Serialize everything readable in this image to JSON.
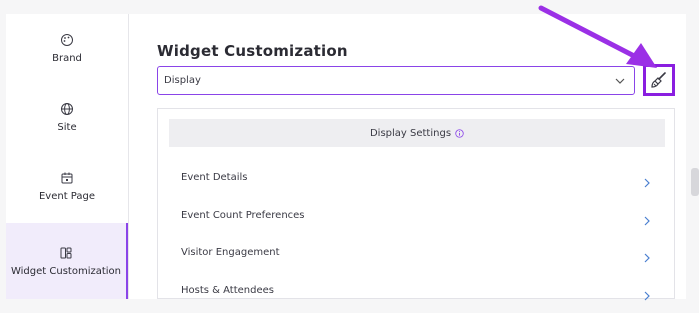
{
  "sidebar": {
    "items": [
      {
        "label": "Brand",
        "icon": "palette-icon"
      },
      {
        "label": "Site",
        "icon": "globe-icon"
      },
      {
        "label": "Event Page",
        "icon": "calendar-icon"
      },
      {
        "label": "Widget Customization",
        "icon": "layout-icon"
      }
    ],
    "active_index": 3
  },
  "main": {
    "title": "Widget Customization",
    "select_value": "Display",
    "brush_icon": "paint-brush-icon",
    "panel": {
      "heading": "Display Settings",
      "rows": [
        {
          "label": "Event Details"
        },
        {
          "label": "Event Count Preferences"
        },
        {
          "label": "Visitor Engagement"
        },
        {
          "label": "Hosts & Attendees"
        }
      ]
    }
  },
  "colors": {
    "accent": "#8a44e8",
    "highlight": "#8a1ee0",
    "arrow": "#9b30e6",
    "chevron_blue": "#4a7fd0"
  }
}
